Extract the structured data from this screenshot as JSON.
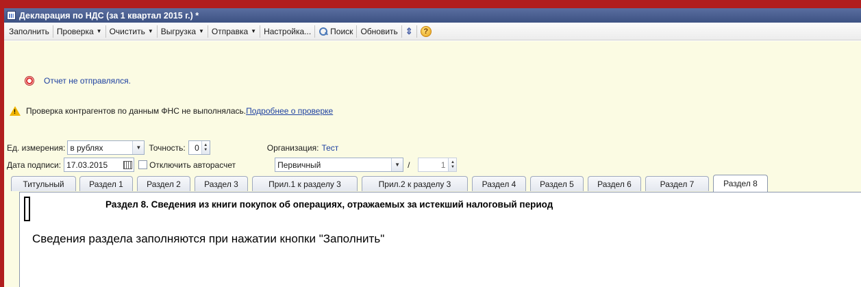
{
  "window": {
    "title": "Декларация по НДС (за 1 квартал 2015 г.) *"
  },
  "toolbar": {
    "fill": "Заполнить",
    "check": "Проверка",
    "clear": "Очистить",
    "export": "Выгрузка",
    "send": "Отправка",
    "settings": "Настройка...",
    "search": "Поиск",
    "refresh": "Обновить"
  },
  "notices": {
    "status": "Отчет не отправлялся.",
    "check_text": "Проверка контрагентов по данным ФНС не выполнялась.",
    "check_link": "Подробнее о проверке"
  },
  "form": {
    "units_label": "Ед. измерения:",
    "units_value": "в рублях",
    "precision_label": "Точность:",
    "precision_value": "0",
    "org_label": "Организация:",
    "org_value": "Тест",
    "date_label": "Дата подписи:",
    "date_value": "17.03.2015",
    "autocalc_label": "Отключить авторасчет",
    "kind_value": "Первичный",
    "slash": "/",
    "correction_value": "1"
  },
  "tabs": [
    {
      "label": "Титульный"
    },
    {
      "label": "Раздел 1"
    },
    {
      "label": "Раздел 2"
    },
    {
      "label": "Раздел 3"
    },
    {
      "label": "Прил.1 к разделу 3"
    },
    {
      "label": "Прил.2 к разделу 3"
    },
    {
      "label": "Раздел 4"
    },
    {
      "label": "Раздел 5"
    },
    {
      "label": "Раздел 6"
    },
    {
      "label": "Раздел 7"
    },
    {
      "label": "Раздел 8"
    }
  ],
  "active_tab": "Раздел 8",
  "section": {
    "title": "Раздел 8. Сведения из книги покупок об операциях, отражаемых за истекший налоговый период",
    "note": "Сведения раздела заполняются при нажатии кнопки \"Заполнить\""
  },
  "colors": {
    "titlebar": "#3d5283",
    "panel": "#fbfbe3",
    "link": "#1c3fa0",
    "frame": "#b11e1e"
  }
}
